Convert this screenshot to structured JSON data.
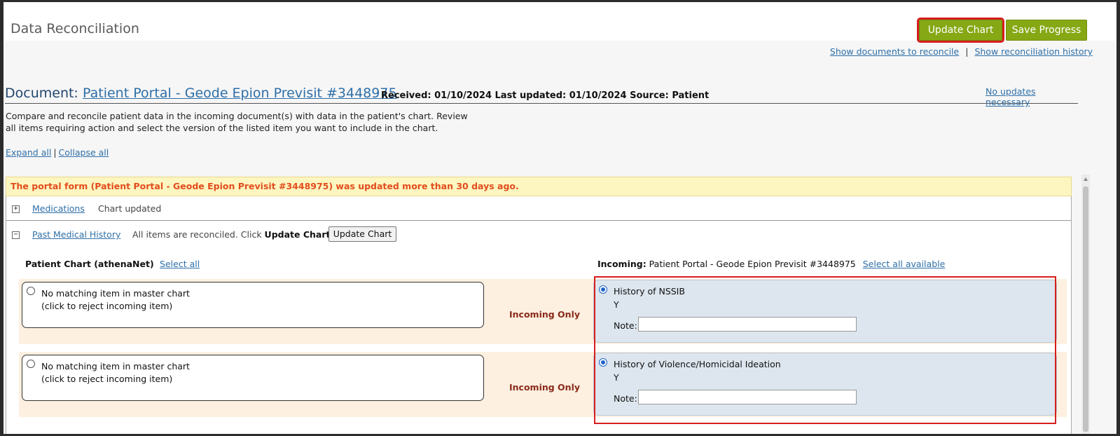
{
  "header": {
    "title": "Data Reconciliation",
    "update_chart_label": "Update Chart",
    "save_progress_label": "Save Progress"
  },
  "top_links": {
    "show_documents": "Show documents to reconcile",
    "separator": "|",
    "show_history": "Show reconciliation history"
  },
  "document": {
    "label": "Document:",
    "name": "Patient Portal - Geode Epion Previsit #3448975",
    "meta": "Received: 01/10/2024 Last updated: 01/10/2024 Source: Patient",
    "no_updates_link": "No updates necessary"
  },
  "description": "Compare and reconcile patient data in the incoming document(s) with data in the patient's chart. Review all items requiring action and select the version of the listed item you want to include in the chart.",
  "expand_controls": {
    "expand_all": "Expand all",
    "separator": "|",
    "collapse_all": "Collapse all"
  },
  "warning": "The portal form (Patient Portal - Geode Epion Previsit #3448975) was updated more than 30 days ago.",
  "sections": {
    "medications": {
      "toggle": "+",
      "label": "Medications",
      "status": "Chart updated"
    },
    "pmh": {
      "toggle": "−",
      "label": "Past Medical History",
      "status_prefix": "All items are reconciled. Click ",
      "status_bold": "Update Chart",
      "button_label": "Update Chart"
    }
  },
  "columns": {
    "left_heading": "Patient Chart (athenaNet)",
    "left_select": "Select all",
    "right_heading_label": "Incoming:",
    "right_heading_value": " Patient Portal - Geode Epion Previsit #3448975",
    "right_select": "Select all available"
  },
  "rows": [
    {
      "chart_line1": "No matching item in master chart",
      "chart_line2": "(click to reject incoming item)",
      "status": "Incoming Only",
      "incoming_title": "History of NSSIB",
      "incoming_value": "Y",
      "note_label": "Note:",
      "note_value": ""
    },
    {
      "chart_line1": "No matching item in master chart",
      "chart_line2": "(click to reject incoming item)",
      "status": "Incoming Only",
      "incoming_title": "History of Violence/Homicidal Ideation",
      "incoming_value": "Y",
      "note_label": "Note:",
      "note_value": ""
    }
  ],
  "colors": {
    "accent_green": "#86a814",
    "highlight_red": "#d81e1e",
    "link_blue": "#2e6fa8",
    "warning_text": "#e24d1d"
  }
}
